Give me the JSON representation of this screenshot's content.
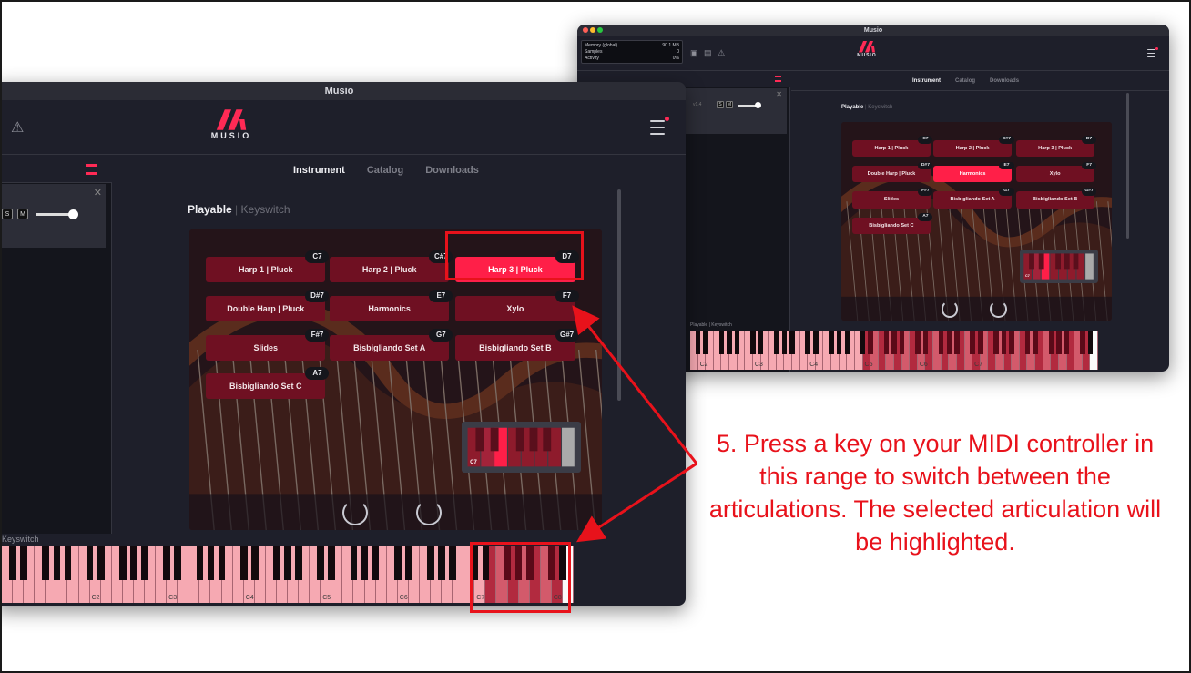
{
  "app": {
    "title": "Musio",
    "logo_text": "MUSIO",
    "tabs": [
      "Instrument",
      "Catalog",
      "Downloads"
    ],
    "active_tab": "Instrument",
    "subtabs": {
      "active": "Playable",
      "separator": "|",
      "inactive": "Keyswitch"
    },
    "keyswitch_label": "Keyswitch",
    "mute_label": "M",
    "version": "v1.4",
    "memory": [
      {
        "label": "Memory (global)",
        "value": "90.1 MB"
      },
      {
        "label": "Samples",
        "value": "0"
      },
      {
        "label": "Activity",
        "value": "0%"
      }
    ]
  },
  "articulations": [
    {
      "label": "Harp 1 | Pluck",
      "note": "C7",
      "selected": false
    },
    {
      "label": "Harp 2 | Pluck",
      "note": "C#7",
      "selected": false
    },
    {
      "label": "Harp 3 | Pluck",
      "note": "D7",
      "selected": true
    },
    {
      "label": "Double Harp | Pluck",
      "note": "D#7",
      "selected": false
    },
    {
      "label": "Harmonics",
      "note": "E7",
      "selected": false
    },
    {
      "label": "Xylo",
      "note": "F7",
      "selected": false
    },
    {
      "label": "Slides",
      "note": "F#7",
      "selected": false
    },
    {
      "label": "Bisbigliando Set A",
      "note": "G7",
      "selected": false
    },
    {
      "label": "Bisbigliando Set B",
      "note": "G#7",
      "selected": false
    },
    {
      "label": "Bisbigliando Set C",
      "note": "A7",
      "selected": false
    }
  ],
  "back_window_selected": "Harmonics",
  "mini_keyboard_label": "C7",
  "octave_labels_front": [
    "C2",
    "C3",
    "C4",
    "C5",
    "C6",
    "C7",
    "C8"
  ],
  "octave_labels_back": [
    "C2",
    "C3",
    "C4",
    "C5",
    "C6",
    "C7"
  ],
  "annotation": "5. Press a key on your MIDI controller in this range to switch between the articulations. The selected articulation will be highlighted.",
  "colors": {
    "accent": "#ff2a55",
    "annotation_red": "#e8121b",
    "window_bg": "#1e1f2a"
  }
}
